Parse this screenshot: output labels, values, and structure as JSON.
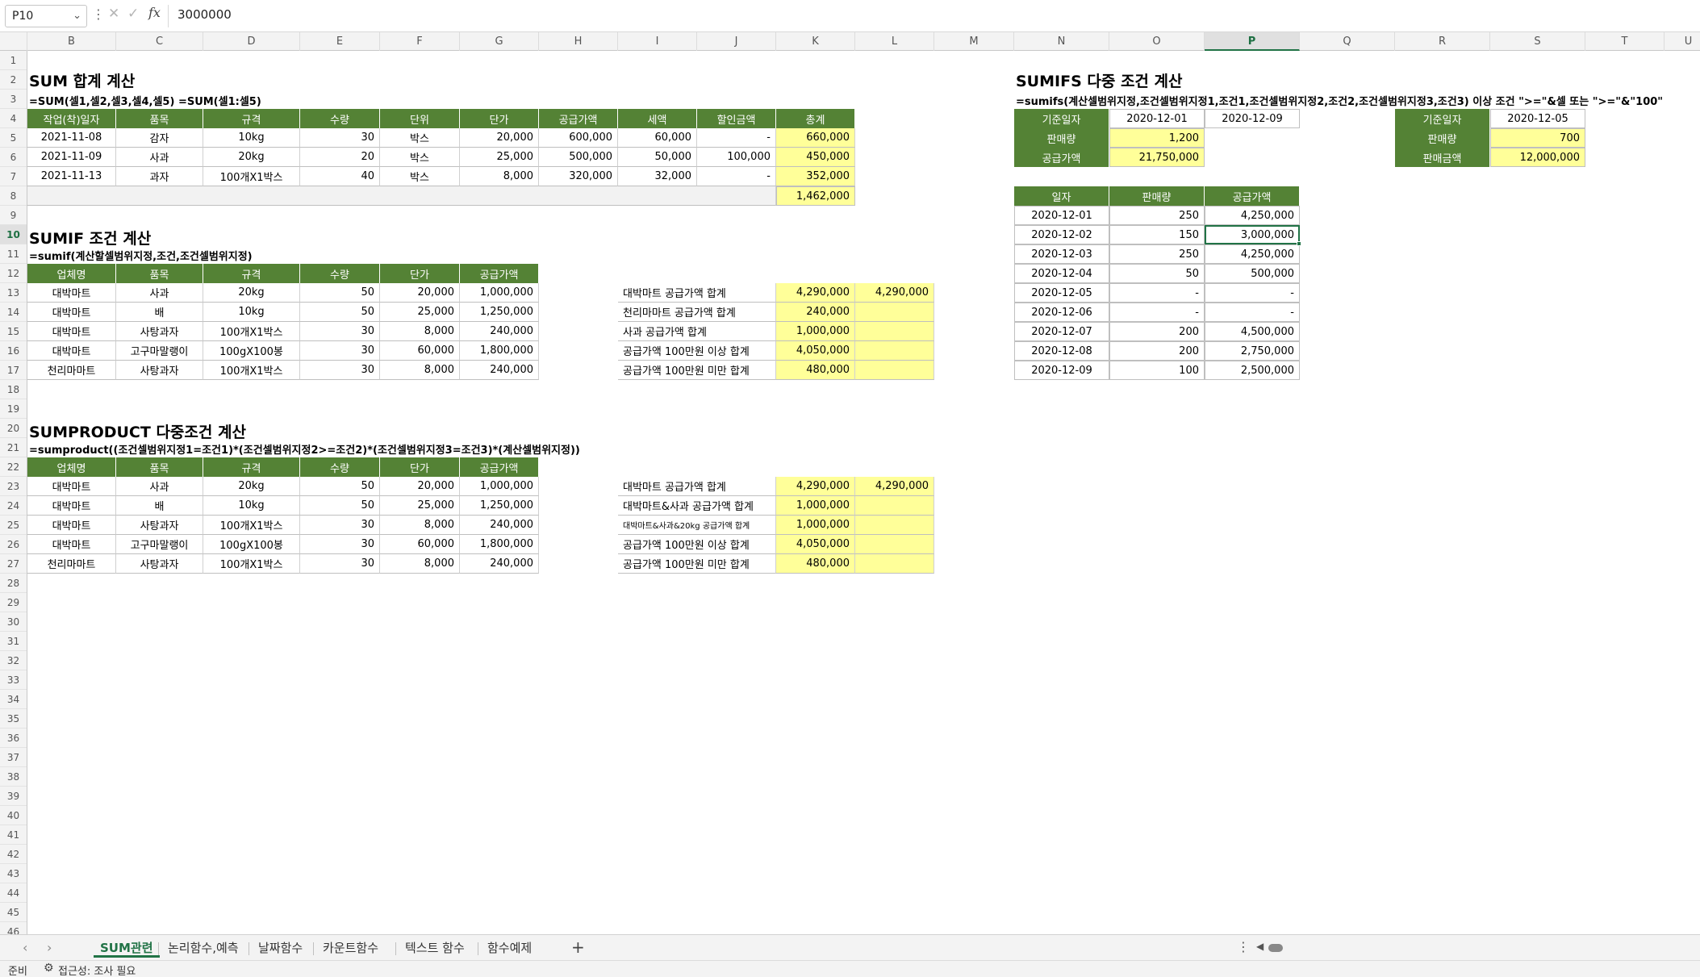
{
  "formula_bar": {
    "name_box": "P10",
    "formula": "3000000"
  },
  "columns": [
    "B",
    "C",
    "D",
    "E",
    "F",
    "G",
    "H",
    "I",
    "J",
    "K",
    "L",
    "M",
    "N",
    "O",
    "P",
    "Q",
    "R",
    "S",
    "T",
    "U"
  ],
  "selected_column": "P",
  "selected_row": 10,
  "sum_section": {
    "title": "SUM 합계 계산",
    "formula": "=SUM(셀1,셀2,셀3,셀4,셀5)   =SUM(셀1:셀5)",
    "headers": [
      "작업(착)일자",
      "품목",
      "규격",
      "수량",
      "단위",
      "단가",
      "공급가액",
      "세액",
      "할인금액",
      "총계"
    ],
    "rows": [
      [
        "2021-11-08",
        "감자",
        "10kg",
        "30",
        "박스",
        "20,000",
        "600,000",
        "60,000",
        "-",
        "660,000"
      ],
      [
        "2021-11-09",
        "사과",
        "20kg",
        "20",
        "박스",
        "25,000",
        "500,000",
        "50,000",
        "100,000",
        "450,000"
      ],
      [
        "2021-11-13",
        "과자",
        "100개X1박스",
        "40",
        "박스",
        "8,000",
        "320,000",
        "32,000",
        "-",
        "352,000"
      ]
    ],
    "total": "1,462,000"
  },
  "sumif_section": {
    "title": "SUMIF 조건 계산",
    "formula": "=sumif(계산할셀범위지정,조건,조건셀범위지정)",
    "headers": [
      "업체명",
      "품목",
      "규격",
      "수량",
      "단가",
      "공급가액"
    ],
    "rows": [
      [
        "대박마트",
        "사과",
        "20kg",
        "50",
        "20,000",
        "1,000,000"
      ],
      [
        "대박마트",
        "배",
        "10kg",
        "50",
        "25,000",
        "1,250,000"
      ],
      [
        "대박마트",
        "사탕과자",
        "100개X1박스",
        "30",
        "8,000",
        "240,000"
      ],
      [
        "대박마트",
        "고구마말랭이",
        "100gX100봉",
        "30",
        "60,000",
        "1,800,000"
      ],
      [
        "천리마마트",
        "사탕과자",
        "100개X1박스",
        "30",
        "8,000",
        "240,000"
      ]
    ],
    "results": [
      {
        "label": "대박마트 공급가액 합계",
        "value": "4,290,000",
        "extra": "4,290,000"
      },
      {
        "label": "천리마마트 공급가액 합계",
        "value": "240,000",
        "extra": ""
      },
      {
        "label": "사과 공급가액 합계",
        "value": "1,000,000",
        "extra": ""
      },
      {
        "label": "공급가액 100만원 이상 합계",
        "value": "4,050,000",
        "extra": ""
      },
      {
        "label": "공급가액 100만원 미만 합계",
        "value": "480,000",
        "extra": ""
      }
    ]
  },
  "sumproduct_section": {
    "title": "SUMPRODUCT 다중조건 계산",
    "formula": "=sumproduct((조건셀범위지정1=조건1)*(조건셀범위지정2>=조건2)*(조건셀범위지정3=조건3)*(계산셀범위지정))",
    "headers": [
      "업체명",
      "품목",
      "규격",
      "수량",
      "단가",
      "공급가액"
    ],
    "rows": [
      [
        "대박마트",
        "사과",
        "20kg",
        "50",
        "20,000",
        "1,000,000"
      ],
      [
        "대박마트",
        "배",
        "10kg",
        "50",
        "25,000",
        "1,250,000"
      ],
      [
        "대박마트",
        "사탕과자",
        "100개X1박스",
        "30",
        "8,000",
        "240,000"
      ],
      [
        "대박마트",
        "고구마말랭이",
        "100gX100봉",
        "30",
        "60,000",
        "1,800,000"
      ],
      [
        "천리마마트",
        "사탕과자",
        "100개X1박스",
        "30",
        "8,000",
        "240,000"
      ]
    ],
    "results": [
      {
        "label": "대박마트 공급가액 합계",
        "value": "4,290,000",
        "extra": "4,290,000"
      },
      {
        "label": "대박마트&사과 공급가액 합계",
        "value": "1,000,000",
        "extra": ""
      },
      {
        "label": "대박마트&사과&20kg 공급가액 합계",
        "value": "1,000,000",
        "extra": ""
      },
      {
        "label": "공급가액 100만원 이상 합계",
        "value": "4,050,000",
        "extra": ""
      },
      {
        "label": "공급가액 100만원 미만 합계",
        "value": "480,000",
        "extra": ""
      }
    ]
  },
  "sumifs_section": {
    "title": "SUMIFS 다중 조건 계산",
    "formula": "=sumifs(계산셀범위지정,조건셀범위지정1,조건1,조건셀범위지정2,조건2,조건셀범위지정3,조건3)    이상 조건 \">=\"&셀 또는 \">=\"&\"100\"",
    "criteria1": {
      "date_label": "기준일자",
      "date_from": "2020-12-01",
      "date_to": "2020-12-09",
      "qty_label": "판매량",
      "qty_value": "1,200",
      "amt_label": "공급가액",
      "amt_value": "21,750,000"
    },
    "criteria2": {
      "date_label": "기준일자",
      "date_value": "2020-12-05",
      "qty_label": "판매량",
      "qty_value": "700",
      "amt_label": "판매금액",
      "amt_value": "12,000,000"
    },
    "headers": [
      "일자",
      "판매량",
      "공급가액"
    ],
    "rows": [
      [
        "2020-12-01",
        "250",
        "4,250,000"
      ],
      [
        "2020-12-02",
        "150",
        "3,000,000"
      ],
      [
        "2020-12-03",
        "250",
        "4,250,000"
      ],
      [
        "2020-12-04",
        "50",
        "500,000"
      ],
      [
        "2020-12-05",
        "-",
        "-"
      ],
      [
        "2020-12-06",
        "-",
        "-"
      ],
      [
        "2020-12-07",
        "200",
        "4,500,000"
      ],
      [
        "2020-12-08",
        "200",
        "2,750,000"
      ],
      [
        "2020-12-09",
        "100",
        "2,500,000"
      ]
    ]
  },
  "sheet_tabs": [
    "SUM관련",
    "논리함수,예측",
    "날짜함수",
    "카운트함수",
    "텍스트 함수",
    "함수예제"
  ],
  "active_tab": "SUM관련",
  "status": {
    "ready": "준비",
    "accessibility": "접근성: 조사 필요"
  },
  "colors": {
    "header_green": "#548235",
    "highlight_yellow": "#ffff99",
    "excel_green": "#217346"
  }
}
